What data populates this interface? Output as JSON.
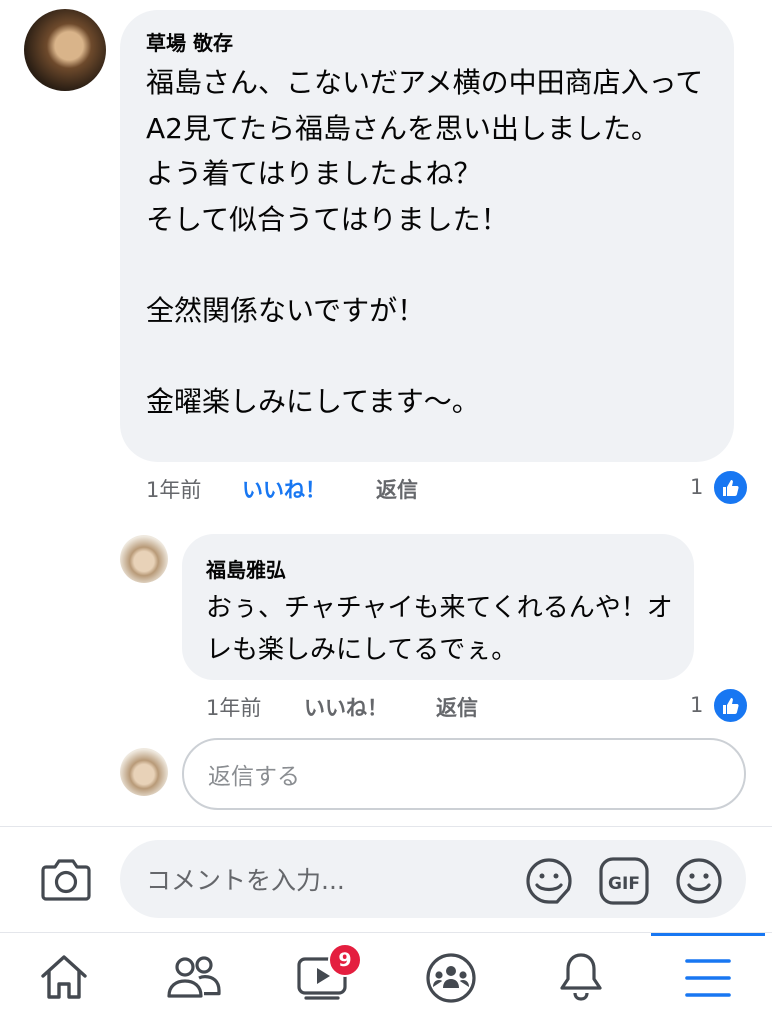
{
  "comment": {
    "author": "草場 敬存",
    "text": "福島さん、こないだアメ横の中田商店入ってA2見てたら福島さんを思い出しました。\nよう着てはりましたよね？\nそして似合うてはりました！\n\n全然関係ないですが！\n\n金曜楽しみにしてます〜。",
    "time": "1年前",
    "like_label": "いいね！",
    "reply_label": "返信",
    "reaction_count": "1",
    "liked": true
  },
  "reply": {
    "author": "福島雅弘",
    "text": "おぅ、チャチャイも来てくれるんや！オレも楽しみにしてるでぇ。",
    "time": "1年前",
    "like_label": "いいね！",
    "reply_label": "返信",
    "reaction_count": "1",
    "liked": false
  },
  "reply_input": {
    "placeholder": "返信する"
  },
  "composer": {
    "placeholder": "コメントを入力..."
  },
  "bottom_nav": {
    "items": [
      {
        "name": "home",
        "icon": "home-icon"
      },
      {
        "name": "friends",
        "icon": "friends-icon"
      },
      {
        "name": "watch",
        "icon": "video-icon",
        "badge": "9"
      },
      {
        "name": "groups",
        "icon": "groups-icon"
      },
      {
        "name": "notifications",
        "icon": "bell-icon"
      },
      {
        "name": "menu",
        "icon": "menu-icon",
        "active": true
      }
    ]
  },
  "colors": {
    "accent": "#1877f2",
    "bubble": "#f0f2f5",
    "badge": "#e41e3f",
    "meta": "#65676b"
  }
}
